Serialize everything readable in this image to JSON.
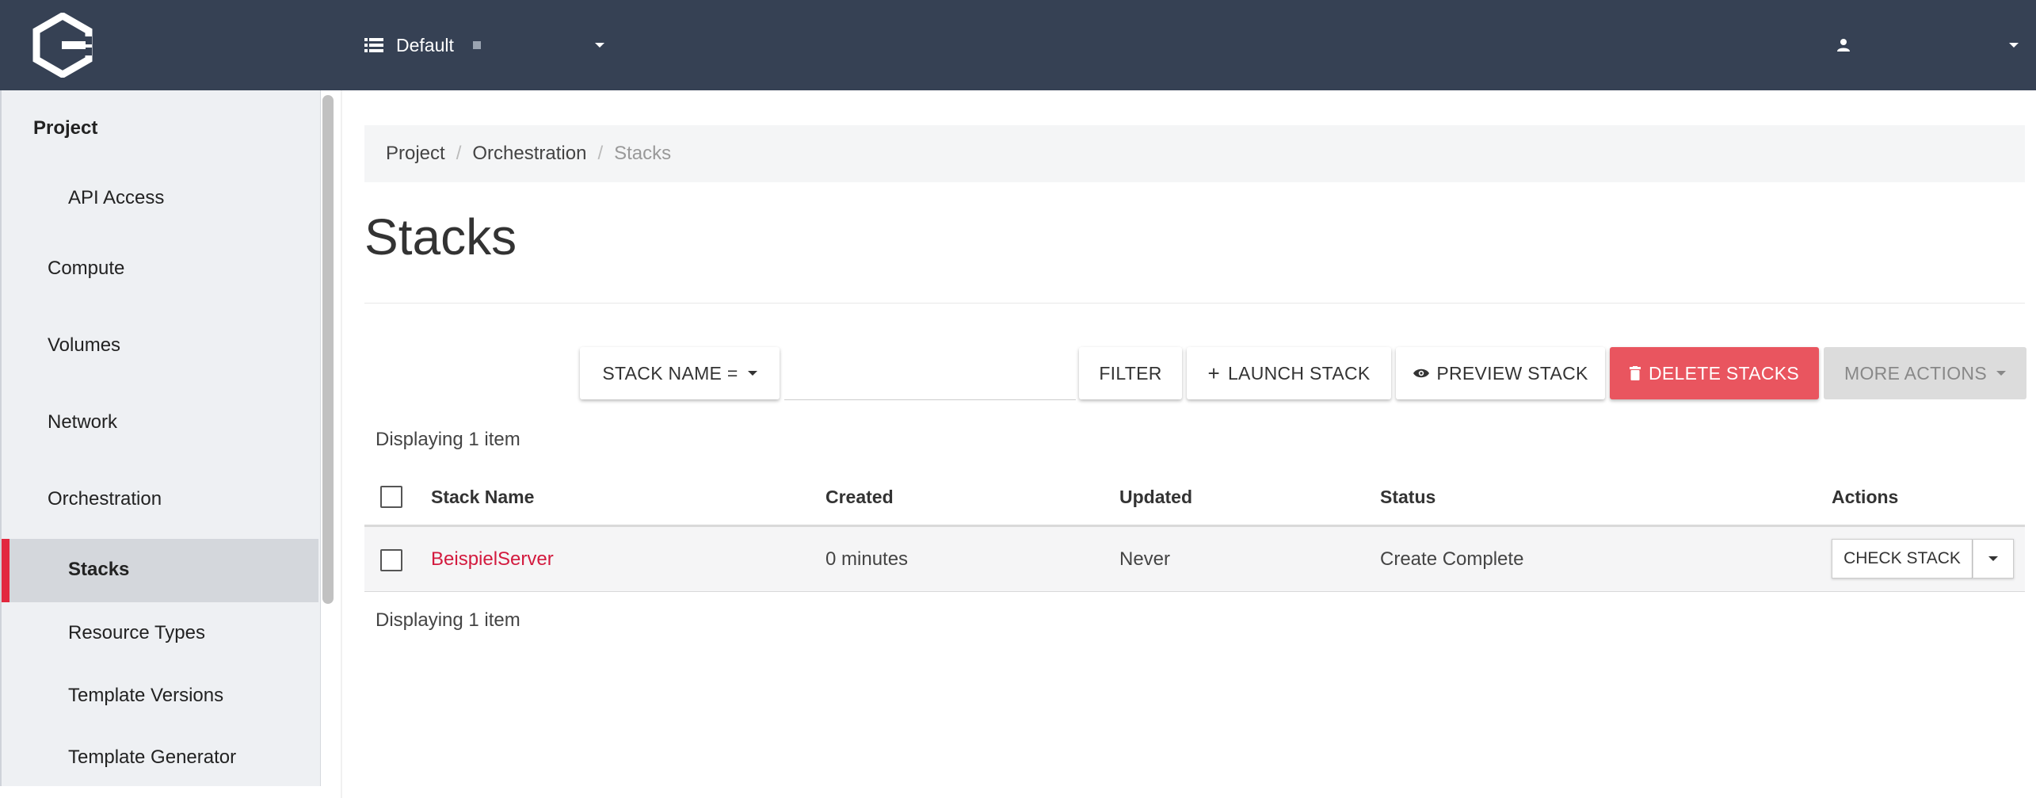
{
  "header": {
    "logo_icon": "openstack-logo-icon",
    "project_switch": {
      "icon": "list-icon",
      "label": "Default"
    },
    "user_menu": {
      "icon": "user-icon"
    }
  },
  "sidebar": {
    "items": [
      {
        "label": "Project",
        "level": 0
      },
      {
        "label": "API Access",
        "level": 2
      },
      {
        "label": "Compute",
        "level": 1
      },
      {
        "label": "Volumes",
        "level": 1
      },
      {
        "label": "Network",
        "level": 1
      },
      {
        "label": "Orchestration",
        "level": 1
      },
      {
        "label": "Stacks",
        "level": 2,
        "active": true
      },
      {
        "label": "Resource Types",
        "level": 2
      },
      {
        "label": "Template Versions",
        "level": 2
      },
      {
        "label": "Template Generator",
        "level": 2
      }
    ],
    "active_color": "#e2283e"
  },
  "breadcrumb": [
    "Project",
    "Orchestration",
    "Stacks"
  ],
  "page": {
    "title": "Stacks"
  },
  "toolbar": {
    "filter_field_label": "STACK NAME =",
    "filter_value": "",
    "filter_button": "FILTER",
    "launch_label": "LAUNCH STACK",
    "preview_label": "PREVIEW STACK",
    "delete_label": "DELETE STACKS",
    "more_label": "MORE ACTIONS"
  },
  "table": {
    "summary_top": "Displaying 1 item",
    "summary_bottom": "Displaying 1 item",
    "columns": [
      "Stack Name",
      "Created",
      "Updated",
      "Status",
      "Actions"
    ],
    "rows": [
      {
        "name": "BeispielServer",
        "created": "0 minutes",
        "updated": "Never",
        "status": "Create Complete",
        "action": "CHECK STACK"
      }
    ]
  },
  "colors": {
    "topbar": "#364154",
    "danger": "#e9555f",
    "link": "#d31a3e"
  }
}
